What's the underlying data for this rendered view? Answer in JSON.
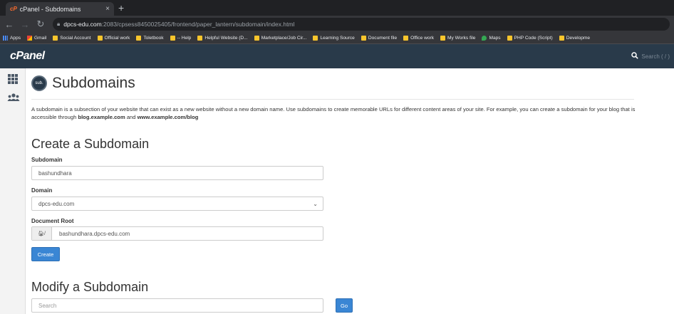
{
  "browser": {
    "tab_title": "cPanel - Subdomains",
    "tab_favicon": "cP",
    "close_glyph": "×",
    "new_tab_glyph": "+",
    "url_host": "dpcs-edu.com",
    "url_path": ":2083/cpsess8450025405/frontend/paper_lantern/subdomain/index.html",
    "bookmarks": [
      {
        "label": "Apps",
        "icon": "apps-grid-icon"
      },
      {
        "label": "Gmail",
        "icon": "gmail-icon"
      },
      {
        "label": "Social Account",
        "icon": "folder-icon"
      },
      {
        "label": "Official work",
        "icon": "folder-icon"
      },
      {
        "label": "Toletbook",
        "icon": "folder-icon"
      },
      {
        "label": "-- Help",
        "icon": "folder-icon"
      },
      {
        "label": "Helpful Website (D...",
        "icon": "folder-icon"
      },
      {
        "label": "Marketplace/Job Cir...",
        "icon": "folder-icon"
      },
      {
        "label": "Learning Source",
        "icon": "folder-icon"
      },
      {
        "label": "Document file",
        "icon": "folder-icon"
      },
      {
        "label": "Office work",
        "icon": "folder-icon"
      },
      {
        "label": "My Works file",
        "icon": "folder-icon"
      },
      {
        "label": "Maps",
        "icon": "maps-icon"
      },
      {
        "label": "PHP Code (Script)",
        "icon": "folder-icon"
      },
      {
        "label": "Developme",
        "icon": "folder-icon"
      }
    ]
  },
  "header": {
    "logo": "cPanel",
    "search_placeholder": "Search ( / )"
  },
  "page": {
    "badge": "sub.",
    "title": "Subdomains",
    "desc_part1": "A subdomain is a subsection of your website that can exist as a new website without a new domain name. Use subdomains to create memorable URLs for different content areas of your site. For example, you can create a subdomain for your blog that is accessible through ",
    "desc_bold1": "blog.example.com",
    "desc_and": " and ",
    "desc_bold2": "www.example.com/blog"
  },
  "create": {
    "heading": "Create a Subdomain",
    "subdomain_label": "Subdomain",
    "subdomain_value": "bashundhara",
    "domain_label": "Domain",
    "domain_value": "dpcs-edu.com",
    "docroot_label": "Document Root",
    "docroot_prefix": "/",
    "docroot_value": "bashundhara.dpcs-edu.com",
    "create_button": "Create"
  },
  "modify": {
    "heading": "Modify a Subdomain",
    "search_placeholder": "Search",
    "go_button": "Go"
  },
  "colors": {
    "cpanel_header": "#293a4a",
    "button_blue": "#3a86d4"
  }
}
